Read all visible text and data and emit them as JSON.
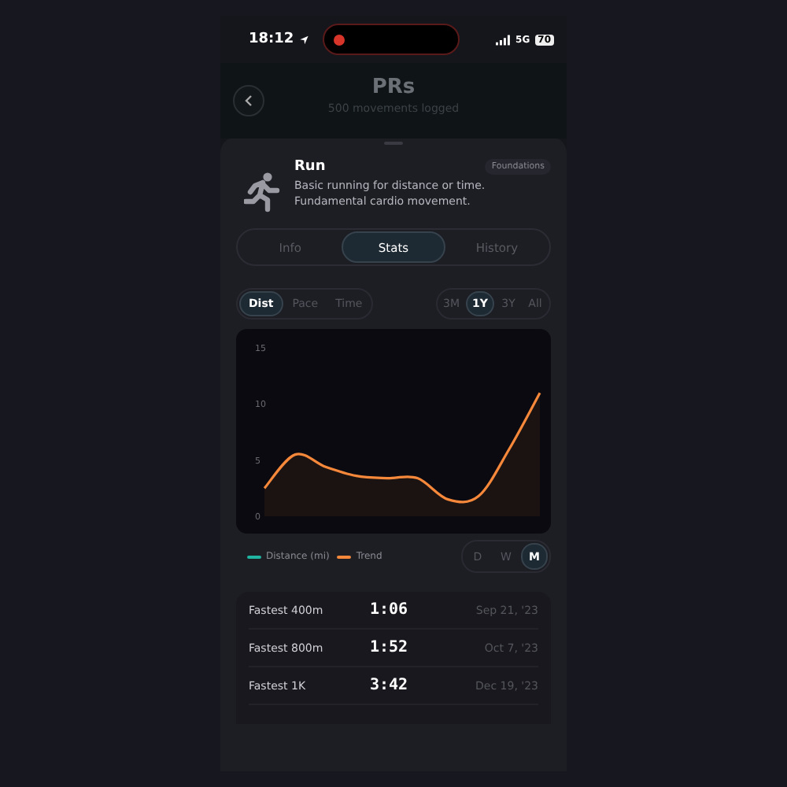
{
  "status_bar": {
    "time": "18:12",
    "network": "5G",
    "battery": "70"
  },
  "header": {
    "title": "PRs",
    "subtitle": "500 movements logged"
  },
  "movement": {
    "name": "Run",
    "tag": "Foundations",
    "description": "Basic running for distance or time. Fundamental cardio movement."
  },
  "tabs": [
    {
      "label": "Info",
      "selected": false
    },
    {
      "label": "Stats",
      "selected": true
    },
    {
      "label": "History",
      "selected": false
    }
  ],
  "metrics": [
    {
      "label": "Dist",
      "selected": true
    },
    {
      "label": "Pace",
      "selected": false
    },
    {
      "label": "Time",
      "selected": false
    }
  ],
  "ranges": [
    {
      "label": "3M",
      "selected": false
    },
    {
      "label": "1Y",
      "selected": true
    },
    {
      "label": "3Y",
      "selected": false
    },
    {
      "label": "All",
      "selected": false
    }
  ],
  "chart_data": {
    "type": "area",
    "ylim": [
      0,
      16.7
    ],
    "yticks": [
      0,
      5,
      10,
      15
    ],
    "series": [
      {
        "name": "Trend",
        "color": "#f5883a",
        "values": [
          2.5,
          5.5,
          4.4,
          3.6,
          3.4,
          3.4,
          1.5,
          1.8,
          6,
          11
        ]
      }
    ]
  },
  "legend": [
    {
      "label": "Distance (mi)",
      "color": "#1fb5a0"
    }
  ],
  "granularity": [
    {
      "label": "D",
      "selected": false
    },
    {
      "label": "W",
      "selected": false
    },
    {
      "label": "M",
      "selected": true
    }
  ],
  "records": [
    {
      "name": "Fastest 400m",
      "value": "1:06",
      "date": "Sep 21, '23"
    },
    {
      "name": "Fastest 800m",
      "value": "1:52",
      "date": "Oct 7, '23"
    },
    {
      "name": "Fastest 1K",
      "value": "3:42",
      "date": "Dec 19, '23"
    }
  ]
}
